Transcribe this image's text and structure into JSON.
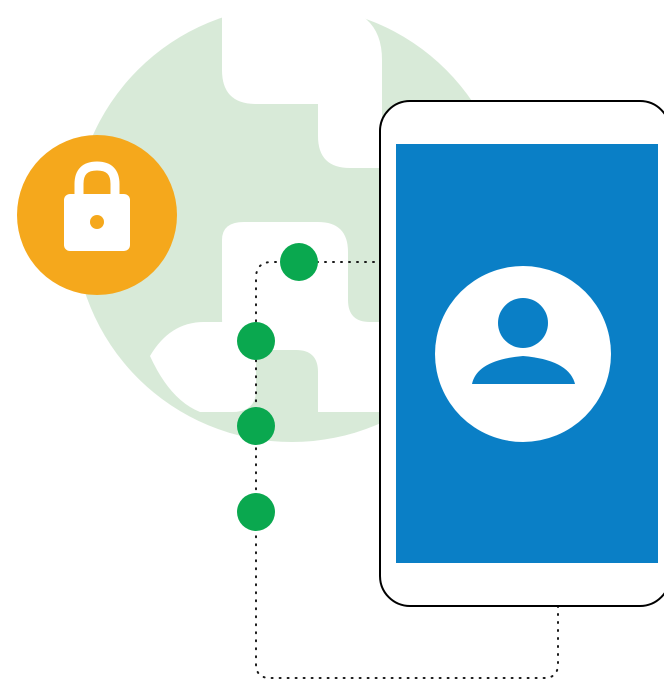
{
  "illustration": {
    "icons": [
      "globe-icon",
      "padlock-icon",
      "smartphone-icon",
      "user-profile-icon",
      "network-node-icon"
    ],
    "colors": {
      "globe": "#d8ead8",
      "lock_badge": "#f5a81c",
      "lock_glyph": "#ffffff",
      "phone_frame": "#000000",
      "phone_body": "#ffffff",
      "screen": "#0a7fc6",
      "avatar_circle": "#ffffff",
      "avatar_figure": "#0a7fc6",
      "nodes": "#0aa84f",
      "dotted_path": "#1a1a1a"
    },
    "node_count": 4
  }
}
